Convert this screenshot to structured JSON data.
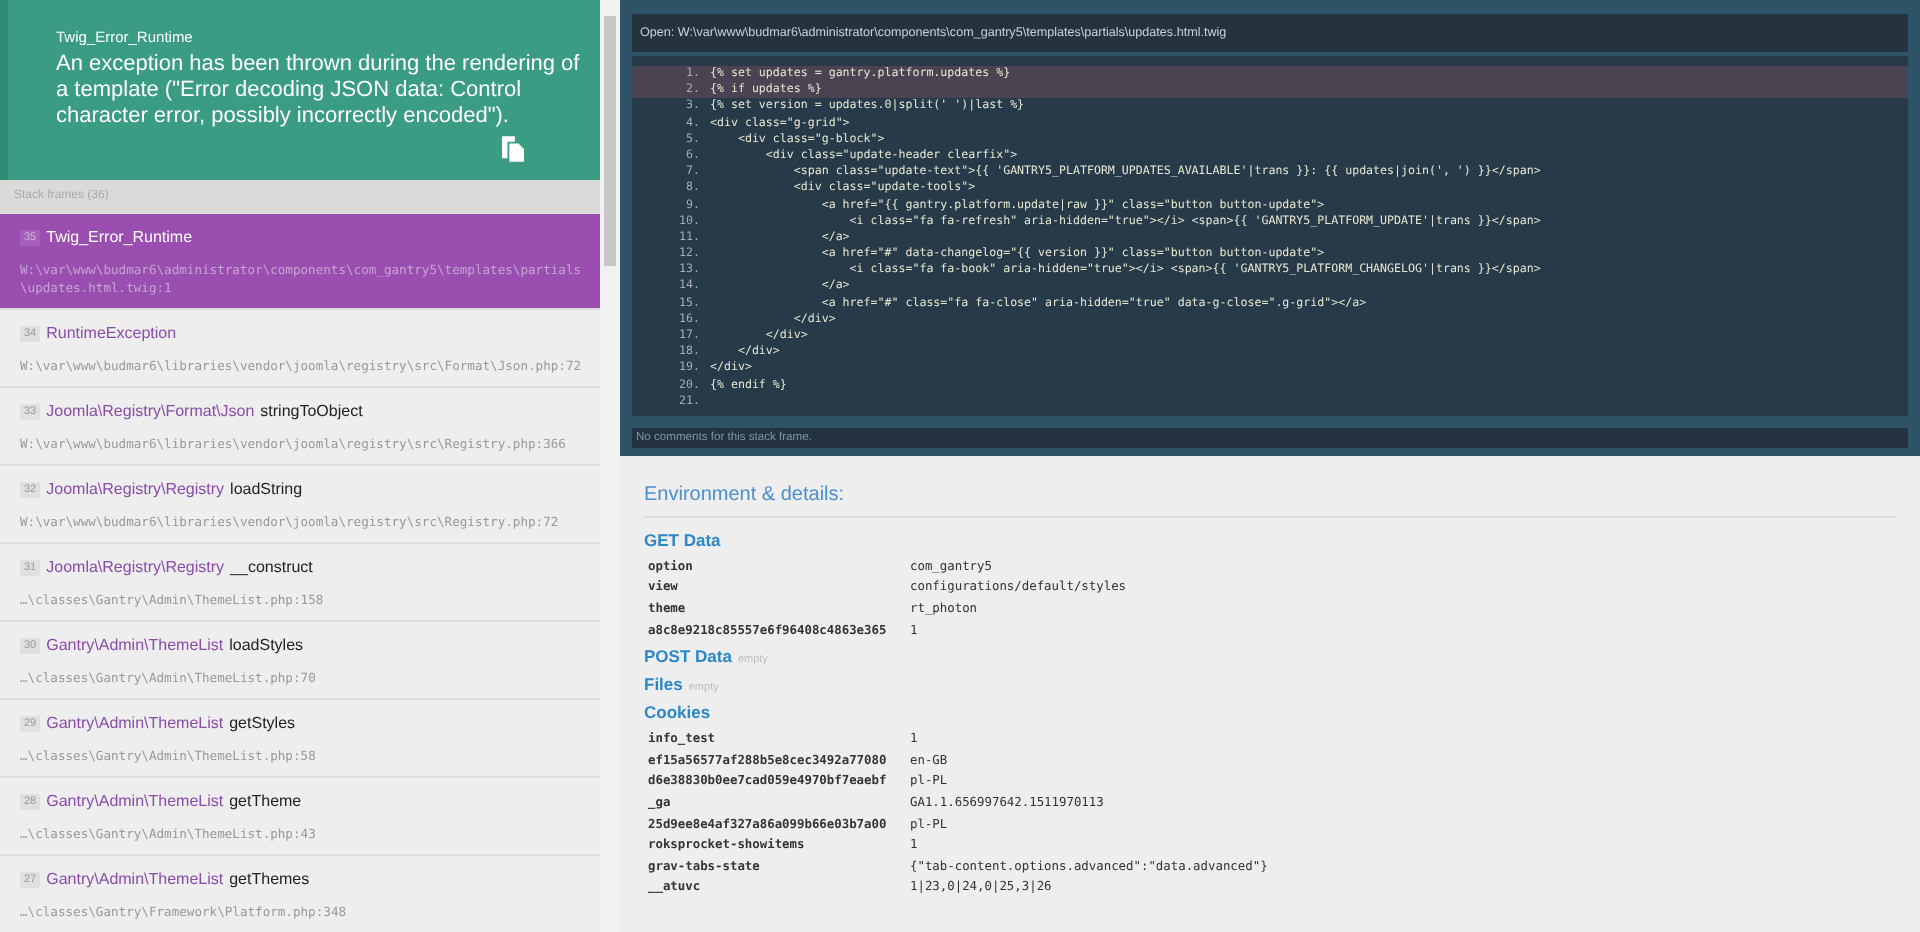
{
  "exception": {
    "type": "Twig_Error_Runtime",
    "message": "An exception has been thrown during the rendering of a template (\"Error decoding JSON data: Control character error, possibly incorrectly encoded\")."
  },
  "stack": {
    "label": "Stack frames (36)",
    "frames": [
      {
        "number": "35",
        "class": "Twig_Error_Runtime",
        "file": "W:\\var\\www\\budmar6\\administrator\\components\\com_gantry5\\templates\\partials\\updates.html.twig",
        "line": ":1",
        "selected": true
      },
      {
        "number": "34",
        "class": "RuntimeException",
        "file": "W:\\var\\www\\budmar6\\libraries\\vendor\\joomla\\registry\\src\\Format\\Json.php",
        "line": ":72",
        "selected": false
      },
      {
        "number": "33",
        "class": "Joomla\\Registry\\Format\\Json",
        "function": "stringToObject",
        "file": "W:\\var\\www\\budmar6\\libraries\\vendor\\joomla\\registry\\src\\Registry.php",
        "line": ":366",
        "selected": false
      },
      {
        "number": "32",
        "class": "Joomla\\Registry\\Registry",
        "function": "loadString",
        "file": "W:\\var\\www\\budmar6\\libraries\\vendor\\joomla\\registry\\src\\Registry.php",
        "line": ":72",
        "selected": false
      },
      {
        "number": "31",
        "class": "Joomla\\Registry\\Registry",
        "function": "__construct",
        "file": "…\\classes\\Gantry\\Admin\\ThemeList.php",
        "line": ":158",
        "selected": false
      },
      {
        "number": "30",
        "class": "Gantry\\Admin\\ThemeList",
        "function": "loadStyles",
        "file": "…\\classes\\Gantry\\Admin\\ThemeList.php",
        "line": ":70",
        "selected": false
      },
      {
        "number": "29",
        "class": "Gantry\\Admin\\ThemeList",
        "function": "getStyles",
        "file": "…\\classes\\Gantry\\Admin\\ThemeList.php",
        "line": ":58",
        "selected": false
      },
      {
        "number": "28",
        "class": "Gantry\\Admin\\ThemeList",
        "function": "getTheme",
        "file": "…\\classes\\Gantry\\Admin\\ThemeList.php",
        "line": ":43",
        "selected": false
      },
      {
        "number": "27",
        "class": "Gantry\\Admin\\ThemeList",
        "function": "getThemes",
        "file": "…\\classes\\Gantry\\Framework\\Platform.php",
        "line": ":348",
        "selected": false
      }
    ]
  },
  "code": {
    "open_label": "Open:",
    "path": "W:\\var\\www\\budmar6\\administrator\\components\\com_gantry5\\templates\\partials\\updates.html.twig",
    "lines": [
      {
        "number": "1.",
        "text": "{% set updates = gantry.platform.updates %}",
        "highlighted": true
      },
      {
        "number": "2.",
        "text": "{% if updates %}",
        "highlighted": true
      },
      {
        "number": "3.",
        "text": "{% set version = updates.0|split(' ')|last %}",
        "highlighted": false
      },
      {
        "number": "4.",
        "text": "<div class=\"g-grid\">",
        "highlighted": false
      },
      {
        "number": "5.",
        "text": "    <div class=\"g-block\">",
        "highlighted": false
      },
      {
        "number": "6.",
        "text": "        <div class=\"update-header clearfix\">",
        "highlighted": false
      },
      {
        "number": "7.",
        "text": "            <span class=\"update-text\">{{ 'GANTRY5_PLATFORM_UPDATES_AVAILABLE'|trans }}: {{ updates|join(', ') }}</span>",
        "highlighted": false
      },
      {
        "number": "8.",
        "text": "            <div class=\"update-tools\">",
        "highlighted": false
      },
      {
        "number": "9.",
        "text": "                <a href=\"{{ gantry.platform.update|raw }}\" class=\"button button-update\">",
        "highlighted": false
      },
      {
        "number": "10.",
        "text": "                    <i class=\"fa fa-refresh\" aria-hidden=\"true\"></i> <span>{{ 'GANTRY5_PLATFORM_UPDATE'|trans }}</span>",
        "highlighted": false
      },
      {
        "number": "11.",
        "text": "                </a>",
        "highlighted": false
      },
      {
        "number": "12.",
        "text": "                <a href=\"#\" data-changelog=\"{{ version }}\" class=\"button button-update\">",
        "highlighted": false
      },
      {
        "number": "13.",
        "text": "                    <i class=\"fa fa-book\" aria-hidden=\"true\"></i> <span>{{ 'GANTRY5_PLATFORM_CHANGELOG'|trans }}</span>",
        "highlighted": false
      },
      {
        "number": "14.",
        "text": "                </a>",
        "highlighted": false
      },
      {
        "number": "15.",
        "text": "                <a href=\"#\" class=\"fa fa-close\" aria-hidden=\"true\" data-g-close=\".g-grid\"></a>",
        "highlighted": false
      },
      {
        "number": "16.",
        "text": "            </div>",
        "highlighted": false
      },
      {
        "number": "17.",
        "text": "        </div>",
        "highlighted": false
      },
      {
        "number": "18.",
        "text": "    </div>",
        "highlighted": false
      },
      {
        "number": "19.",
        "text": "</div>",
        "highlighted": false
      },
      {
        "number": "20.",
        "text": "{% endif %}",
        "highlighted": false
      },
      {
        "number": "21.",
        "highlighted": false
      }
    ],
    "comments": "No comments for this stack frame."
  },
  "details": {
    "title": "Environment & details:",
    "sections": [
      {
        "title": "GET Data",
        "rows": [
          [
            "option",
            "com_gantry5"
          ],
          [
            "view",
            "configurations/default/styles"
          ],
          [
            "theme",
            "rt_photon"
          ],
          [
            "a8c8e9218c85557e6f96408c4863e365",
            "1"
          ]
        ]
      },
      {
        "title": "POST Data",
        "empty_label": "empty"
      },
      {
        "title": "Files",
        "empty_label": "empty"
      },
      {
        "title": "Cookies",
        "rows": [
          [
            "info_test",
            "1"
          ],
          [
            "ef15a56577af288b5e8cec3492a77080",
            "en-GB"
          ],
          [
            "d6e38830b0ee7cad059e4970bf7eaebf",
            "pl-PL"
          ],
          [
            "_ga",
            "GA1.1.656997642.1511970113"
          ],
          [
            "25d9ee8e4af327a86a099b66e03b7a00",
            "pl-PL"
          ],
          [
            "roksprocket-showitems",
            "1"
          ],
          [
            "grav-tabs-state",
            "{\"tab-content.options.advanced\":\"data.advanced\"}"
          ],
          [
            "__atuvc",
            "1|23,0|24,0|25,3|26"
          ]
        ]
      }
    ]
  }
}
